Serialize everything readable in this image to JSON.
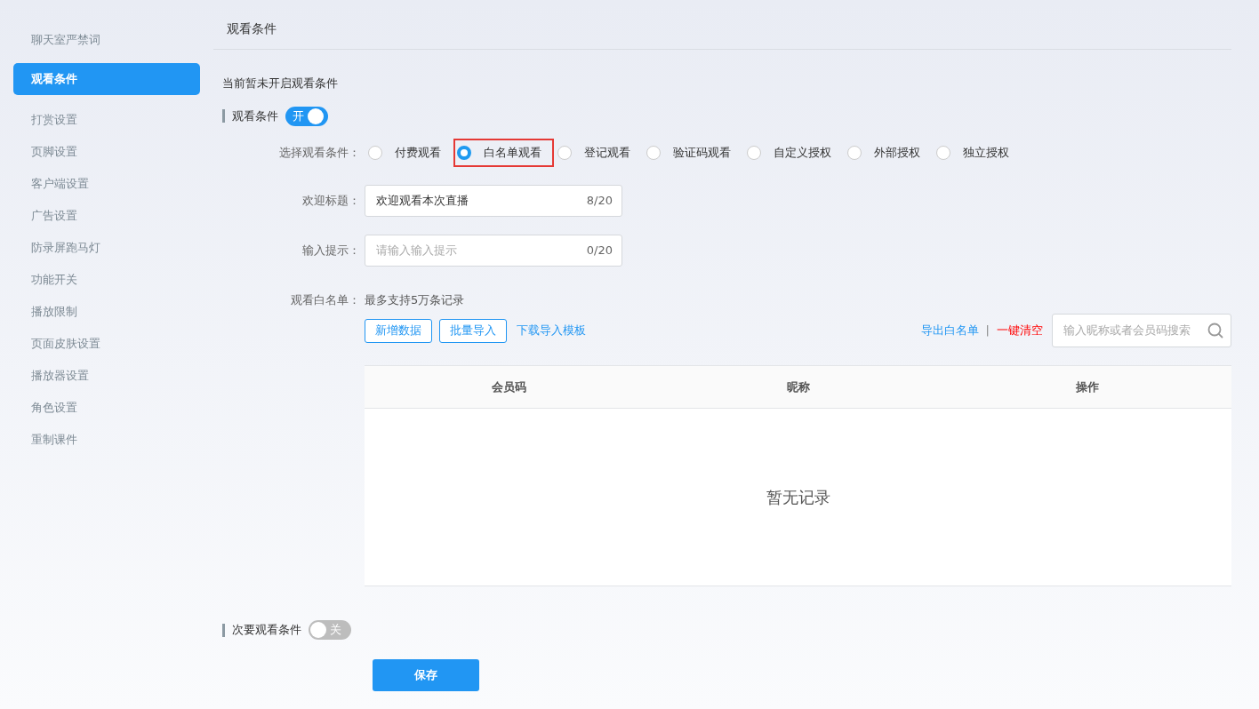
{
  "sidebar": {
    "items": [
      {
        "label": "聊天室严禁词",
        "selected": false
      },
      {
        "label": "观看条件",
        "selected": true
      },
      {
        "label": "打赏设置",
        "selected": false
      },
      {
        "label": "页脚设置",
        "selected": false
      },
      {
        "label": "客户端设置",
        "selected": false
      },
      {
        "label": "广告设置",
        "selected": false
      },
      {
        "label": "防录屏跑马灯",
        "selected": false
      },
      {
        "label": "功能开关",
        "selected": false
      },
      {
        "label": "播放限制",
        "selected": false
      },
      {
        "label": "页面皮肤设置",
        "selected": false
      },
      {
        "label": "播放器设置",
        "selected": false
      },
      {
        "label": "角色设置",
        "selected": false
      },
      {
        "label": "重制课件",
        "selected": false
      }
    ]
  },
  "page_title": "观看条件",
  "notice": "当前暂未开启观看条件",
  "primary_condition": {
    "label": "观看条件",
    "on": true,
    "switch_text": "开"
  },
  "condition_select": {
    "label": "选择观看条件：",
    "options": [
      {
        "label": "付费观看",
        "selected": false,
        "highlighted": false
      },
      {
        "label": "白名单观看",
        "selected": true,
        "highlighted": true
      },
      {
        "label": "登记观看",
        "selected": false,
        "highlighted": false
      },
      {
        "label": "验证码观看",
        "selected": false,
        "highlighted": false
      },
      {
        "label": "自定义授权",
        "selected": false,
        "highlighted": false
      },
      {
        "label": "外部授权",
        "selected": false,
        "highlighted": false
      },
      {
        "label": "独立授权",
        "selected": false,
        "highlighted": false
      }
    ]
  },
  "fields": [
    {
      "label": "欢迎标题：",
      "value": "欢迎观看本次直播",
      "counter": "8/20"
    },
    {
      "label": "输入提示：",
      "placeholder": "请输入输入提示",
      "counter": "0/20"
    }
  ],
  "whitelist": {
    "label": "观看白名单：",
    "hint": "最多支持5万条记录",
    "buttons": [
      "新增数据",
      "批量导入"
    ],
    "template_link": "下载导入模板",
    "export_link": "导出白名单",
    "separator": "|",
    "clear_link": "一键清空",
    "search": {
      "placeholder": "输入昵称或者会员码搜索"
    },
    "table": {
      "columns": [
        "会员码",
        "昵称",
        "操作"
      ],
      "empty_text": "暂无记录"
    }
  },
  "secondary_condition": {
    "label": "次要观看条件",
    "on": false,
    "switch_text": "关"
  },
  "save_button": "保存"
}
